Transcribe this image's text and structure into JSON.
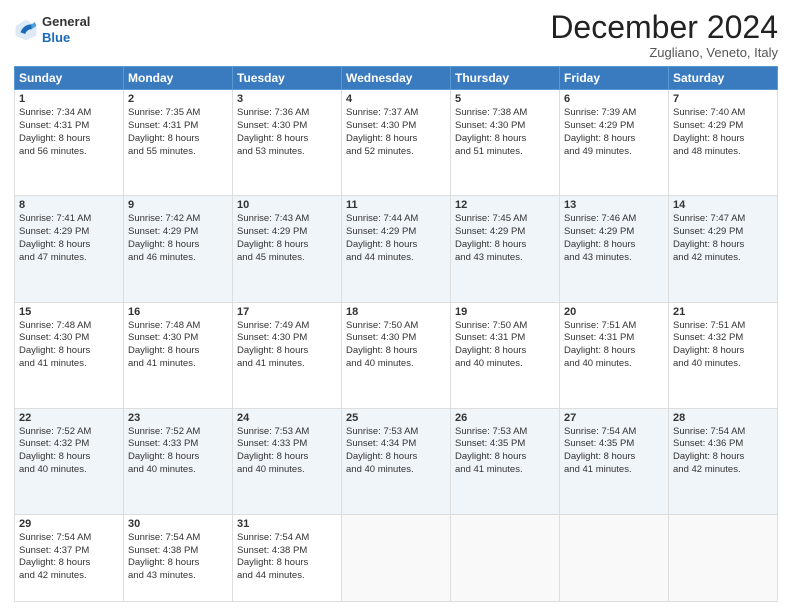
{
  "header": {
    "logo_general": "General",
    "logo_blue": "Blue",
    "month_title": "December 2024",
    "location": "Zugliano, Veneto, Italy"
  },
  "days_of_week": [
    "Sunday",
    "Monday",
    "Tuesday",
    "Wednesday",
    "Thursday",
    "Friday",
    "Saturday"
  ],
  "weeks": [
    [
      {
        "day": 1,
        "lines": [
          "Sunrise: 7:34 AM",
          "Sunset: 4:31 PM",
          "Daylight: 8 hours",
          "and 56 minutes."
        ]
      },
      {
        "day": 2,
        "lines": [
          "Sunrise: 7:35 AM",
          "Sunset: 4:31 PM",
          "Daylight: 8 hours",
          "and 55 minutes."
        ]
      },
      {
        "day": 3,
        "lines": [
          "Sunrise: 7:36 AM",
          "Sunset: 4:30 PM",
          "Daylight: 8 hours",
          "and 53 minutes."
        ]
      },
      {
        "day": 4,
        "lines": [
          "Sunrise: 7:37 AM",
          "Sunset: 4:30 PM",
          "Daylight: 8 hours",
          "and 52 minutes."
        ]
      },
      {
        "day": 5,
        "lines": [
          "Sunrise: 7:38 AM",
          "Sunset: 4:30 PM",
          "Daylight: 8 hours",
          "and 51 minutes."
        ]
      },
      {
        "day": 6,
        "lines": [
          "Sunrise: 7:39 AM",
          "Sunset: 4:29 PM",
          "Daylight: 8 hours",
          "and 49 minutes."
        ]
      },
      {
        "day": 7,
        "lines": [
          "Sunrise: 7:40 AM",
          "Sunset: 4:29 PM",
          "Daylight: 8 hours",
          "and 48 minutes."
        ]
      }
    ],
    [
      {
        "day": 8,
        "lines": [
          "Sunrise: 7:41 AM",
          "Sunset: 4:29 PM",
          "Daylight: 8 hours",
          "and 47 minutes."
        ]
      },
      {
        "day": 9,
        "lines": [
          "Sunrise: 7:42 AM",
          "Sunset: 4:29 PM",
          "Daylight: 8 hours",
          "and 46 minutes."
        ]
      },
      {
        "day": 10,
        "lines": [
          "Sunrise: 7:43 AM",
          "Sunset: 4:29 PM",
          "Daylight: 8 hours",
          "and 45 minutes."
        ]
      },
      {
        "day": 11,
        "lines": [
          "Sunrise: 7:44 AM",
          "Sunset: 4:29 PM",
          "Daylight: 8 hours",
          "and 44 minutes."
        ]
      },
      {
        "day": 12,
        "lines": [
          "Sunrise: 7:45 AM",
          "Sunset: 4:29 PM",
          "Daylight: 8 hours",
          "and 43 minutes."
        ]
      },
      {
        "day": 13,
        "lines": [
          "Sunrise: 7:46 AM",
          "Sunset: 4:29 PM",
          "Daylight: 8 hours",
          "and 43 minutes."
        ]
      },
      {
        "day": 14,
        "lines": [
          "Sunrise: 7:47 AM",
          "Sunset: 4:29 PM",
          "Daylight: 8 hours",
          "and 42 minutes."
        ]
      }
    ],
    [
      {
        "day": 15,
        "lines": [
          "Sunrise: 7:48 AM",
          "Sunset: 4:30 PM",
          "Daylight: 8 hours",
          "and 41 minutes."
        ]
      },
      {
        "day": 16,
        "lines": [
          "Sunrise: 7:48 AM",
          "Sunset: 4:30 PM",
          "Daylight: 8 hours",
          "and 41 minutes."
        ]
      },
      {
        "day": 17,
        "lines": [
          "Sunrise: 7:49 AM",
          "Sunset: 4:30 PM",
          "Daylight: 8 hours",
          "and 41 minutes."
        ]
      },
      {
        "day": 18,
        "lines": [
          "Sunrise: 7:50 AM",
          "Sunset: 4:30 PM",
          "Daylight: 8 hours",
          "and 40 minutes."
        ]
      },
      {
        "day": 19,
        "lines": [
          "Sunrise: 7:50 AM",
          "Sunset: 4:31 PM",
          "Daylight: 8 hours",
          "and 40 minutes."
        ]
      },
      {
        "day": 20,
        "lines": [
          "Sunrise: 7:51 AM",
          "Sunset: 4:31 PM",
          "Daylight: 8 hours",
          "and 40 minutes."
        ]
      },
      {
        "day": 21,
        "lines": [
          "Sunrise: 7:51 AM",
          "Sunset: 4:32 PM",
          "Daylight: 8 hours",
          "and 40 minutes."
        ]
      }
    ],
    [
      {
        "day": 22,
        "lines": [
          "Sunrise: 7:52 AM",
          "Sunset: 4:32 PM",
          "Daylight: 8 hours",
          "and 40 minutes."
        ]
      },
      {
        "day": 23,
        "lines": [
          "Sunrise: 7:52 AM",
          "Sunset: 4:33 PM",
          "Daylight: 8 hours",
          "and 40 minutes."
        ]
      },
      {
        "day": 24,
        "lines": [
          "Sunrise: 7:53 AM",
          "Sunset: 4:33 PM",
          "Daylight: 8 hours",
          "and 40 minutes."
        ]
      },
      {
        "day": 25,
        "lines": [
          "Sunrise: 7:53 AM",
          "Sunset: 4:34 PM",
          "Daylight: 8 hours",
          "and 40 minutes."
        ]
      },
      {
        "day": 26,
        "lines": [
          "Sunrise: 7:53 AM",
          "Sunset: 4:35 PM",
          "Daylight: 8 hours",
          "and 41 minutes."
        ]
      },
      {
        "day": 27,
        "lines": [
          "Sunrise: 7:54 AM",
          "Sunset: 4:35 PM",
          "Daylight: 8 hours",
          "and 41 minutes."
        ]
      },
      {
        "day": 28,
        "lines": [
          "Sunrise: 7:54 AM",
          "Sunset: 4:36 PM",
          "Daylight: 8 hours",
          "and 42 minutes."
        ]
      }
    ],
    [
      {
        "day": 29,
        "lines": [
          "Sunrise: 7:54 AM",
          "Sunset: 4:37 PM",
          "Daylight: 8 hours",
          "and 42 minutes."
        ]
      },
      {
        "day": 30,
        "lines": [
          "Sunrise: 7:54 AM",
          "Sunset: 4:38 PM",
          "Daylight: 8 hours",
          "and 43 minutes."
        ]
      },
      {
        "day": 31,
        "lines": [
          "Sunrise: 7:54 AM",
          "Sunset: 4:38 PM",
          "Daylight: 8 hours",
          "and 44 minutes."
        ]
      },
      null,
      null,
      null,
      null
    ]
  ]
}
